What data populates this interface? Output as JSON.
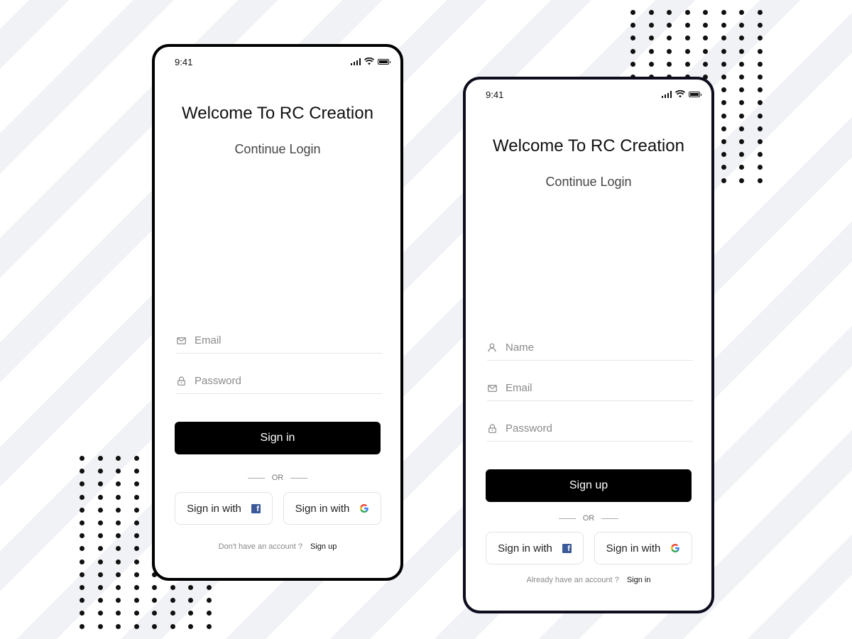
{
  "colors": {
    "background": "#ffffff",
    "stripe": "#f1f2f5",
    "primary_button": "#000000",
    "phone_border_login": "#000000",
    "phone_border_signup": "#0e0d1d",
    "facebook": "#3b5998"
  },
  "login_screen": {
    "status_time": "9:41",
    "welcome": "Welcome To  RC Creation",
    "subtitle": "Continue Login",
    "email_placeholder": "Email",
    "password_placeholder": "Password",
    "primary_button": "Sign in",
    "or_text": "OR",
    "facebook_button": "Sign in with",
    "google_button": "Sign in with",
    "footer_text": "Don't have an account ?",
    "footer_link": "Sign up"
  },
  "signup_screen": {
    "status_time": "9:41",
    "welcome": "Welcome To  RC Creation",
    "subtitle": "Continue Login",
    "name_placeholder": "Name",
    "email_placeholder": "Email",
    "password_placeholder": "Password",
    "primary_button": "Sign up",
    "or_text": "OR",
    "facebook_button": "Sign in with",
    "google_button": "Sign in with",
    "footer_text": "Already have an account ?",
    "footer_link": "Sign in"
  },
  "icons": {
    "email": "mail-icon",
    "password": "lock-icon",
    "name": "user-icon",
    "facebook": "facebook-icon",
    "google": "google-icon",
    "signal": "signal-icon",
    "wifi": "wifi-icon",
    "battery": "battery-icon"
  }
}
